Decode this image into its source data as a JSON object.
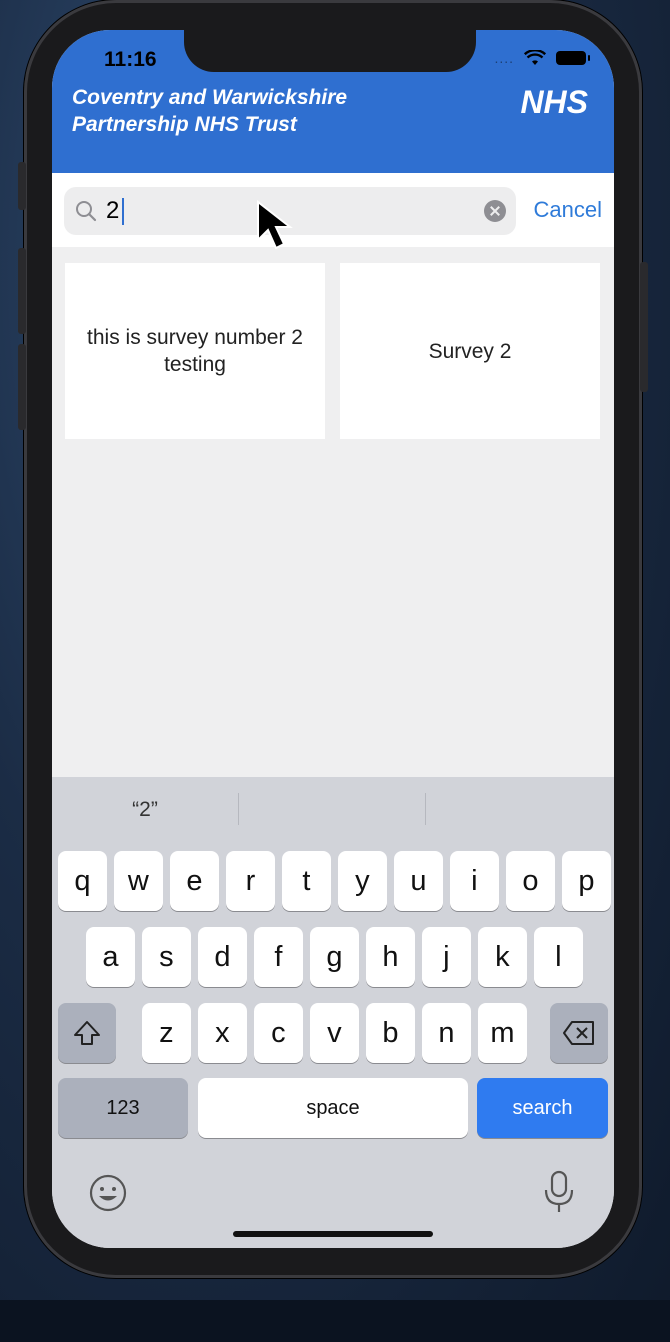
{
  "status_bar": {
    "time": "11:16",
    "signal": "....",
    "icons": [
      "wifi-icon",
      "battery-icon"
    ]
  },
  "header": {
    "org_name": "Coventry and Warwickshire Partnership NHS Trust",
    "logo": "NHS",
    "color": "#2f6fd0"
  },
  "search": {
    "value": "2",
    "cancel_label": "Cancel"
  },
  "results": [
    {
      "title": "this is survey number 2 testing"
    },
    {
      "title": "Survey 2"
    }
  ],
  "keyboard": {
    "suggestions": [
      "“2”",
      "",
      ""
    ],
    "row1": [
      "q",
      "w",
      "e",
      "r",
      "t",
      "y",
      "u",
      "i",
      "o",
      "p"
    ],
    "row2": [
      "a",
      "s",
      "d",
      "f",
      "g",
      "h",
      "j",
      "k",
      "l"
    ],
    "row3": [
      "z",
      "x",
      "c",
      "v",
      "b",
      "n",
      "m"
    ],
    "numbers_label": "123",
    "space_label": "space",
    "search_label": "search",
    "accent_color": "#2f7bf0"
  }
}
